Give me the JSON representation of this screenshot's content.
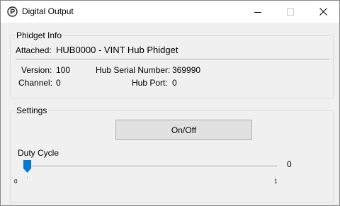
{
  "window": {
    "title": "Digital Output",
    "controls": {
      "minimize": "minimize",
      "maximize": "maximize",
      "close": "close"
    }
  },
  "phidget_info": {
    "legend": "Phidget Info",
    "attached_label": "Attached:",
    "attached_value": "HUB0000 - VINT Hub Phidget",
    "version_label": "Version:",
    "version_value": "100",
    "serial_label": "Hub Serial Number:",
    "serial_value": "369990",
    "channel_label": "Channel:",
    "channel_value": "0",
    "hub_port_label": "Hub Port:",
    "hub_port_value": "0"
  },
  "settings": {
    "legend": "Settings",
    "onoff_label": "On/Off",
    "duty_cycle_label": "Duty Cycle",
    "duty_cycle_value": "0",
    "slider_min_label": "0",
    "slider_max_label": "1",
    "slider_level": 0
  },
  "colors": {
    "accent": "#0078d7",
    "window_bg": "#f0f0f0",
    "titlebar_bg": "#ffffff"
  },
  "icons": {
    "app": "phidgets-logo-icon",
    "minimize": "minimize-icon",
    "maximize": "maximize-icon",
    "close": "close-icon"
  }
}
